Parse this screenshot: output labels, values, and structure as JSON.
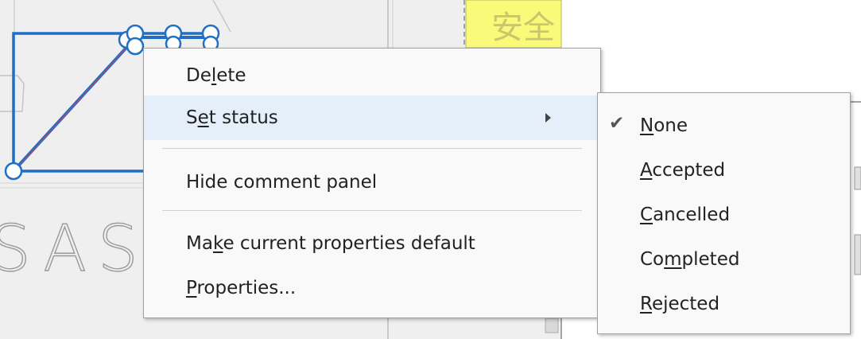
{
  "background": {
    "drawing_text": "SASTA",
    "yellow_label_glyphs": "安全"
  },
  "context_menu": {
    "items": [
      {
        "pre": "De",
        "key": "l",
        "post": "ete"
      },
      {
        "pre": "S",
        "key": "e",
        "post": "t status"
      },
      {
        "pre": "Hide comment panel",
        "key": "",
        "post": ""
      },
      {
        "pre": "Ma",
        "key": "k",
        "post": "e current properties default"
      },
      {
        "pre": "",
        "key": "P",
        "post": "roperties..."
      }
    ]
  },
  "status_submenu": {
    "selected": "None",
    "check_glyph": "✔",
    "items": [
      {
        "pre": "",
        "key": "N",
        "post": "one"
      },
      {
        "pre": "",
        "key": "A",
        "post": "ccepted"
      },
      {
        "pre": "",
        "key": "C",
        "post": "ancelled"
      },
      {
        "pre": "Co",
        "key": "m",
        "post": "pleted"
      },
      {
        "pre": "",
        "key": "R",
        "post": "ejected"
      }
    ]
  },
  "colors": {
    "selection": "#1f6fc5",
    "highlight": "#e5eff9",
    "yellow_label": "#f9f97a"
  }
}
